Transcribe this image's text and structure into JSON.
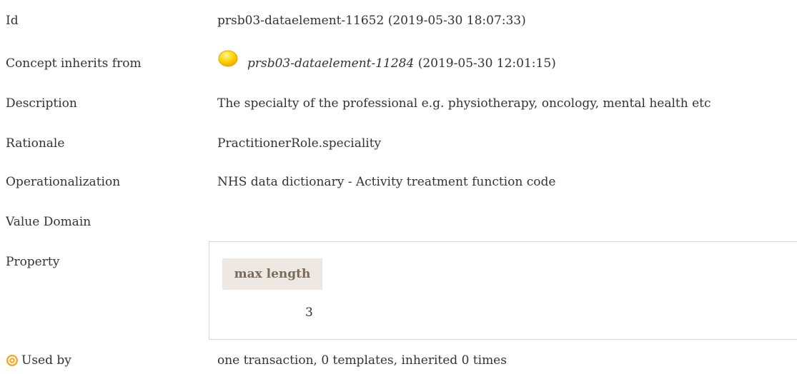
{
  "rows": {
    "id": {
      "label": "Id",
      "value": "prsb03-dataelement-11652 (2019-05-30 18:07:33)"
    },
    "concept": {
      "label": "Concept inherits from",
      "link": "prsb03-dataelement-11284",
      "suffix": " (2019-05-30 12:01:15)",
      "icon": "yellow-circle-icon"
    },
    "description": {
      "label": "Description",
      "value": "The specialty of the professional e.g. physiotherapy, oncology, mental health etc"
    },
    "rationale": {
      "label": "Rationale",
      "value": "PractitionerRole.speciality"
    },
    "operationalization": {
      "label": "Operationalization",
      "value": "NHS data dictionary - Activity treatment function code"
    },
    "value_domain": {
      "label": "Value Domain"
    },
    "property": {
      "label": "Property",
      "header": "max length",
      "value": "3"
    },
    "used_by": {
      "label": "Used by",
      "value": "one transaction, 0 templates, inherited 0 times",
      "icon": "target-icon"
    }
  },
  "colors": {
    "text": "#333333",
    "header_bg": "#ede8e2",
    "header_text": "#7a6a5a",
    "icon_orange": "#f5a623",
    "icon_yellow": "#ffd400"
  }
}
